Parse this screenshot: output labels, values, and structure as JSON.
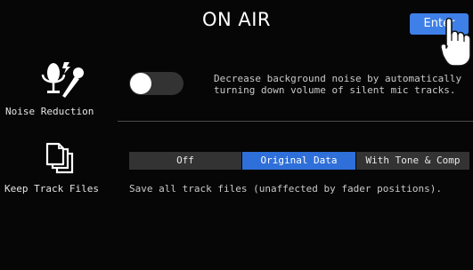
{
  "screen": {
    "title": "ON AIR",
    "enter_label": "Enter"
  },
  "noise_reduction": {
    "label": "Noise Reduction",
    "icon": "microphone-noise-icon",
    "toggle_state": "off",
    "description_line1": "Decrease background noise by automatically",
    "description_line2": "turning down volume of silent mic tracks."
  },
  "keep_track_files": {
    "label": "Keep Track Files",
    "icon": "documents-icon",
    "options": [
      "Off",
      "Original Data",
      "With Tone & Comp"
    ],
    "selected": "Original Data",
    "description": "Save all track files (unaffected by fader positions)."
  },
  "colors": {
    "accent": "#3f7fe8",
    "selected_segment": "#2f6fd9",
    "control_bg": "#333333",
    "background": "#060606"
  }
}
